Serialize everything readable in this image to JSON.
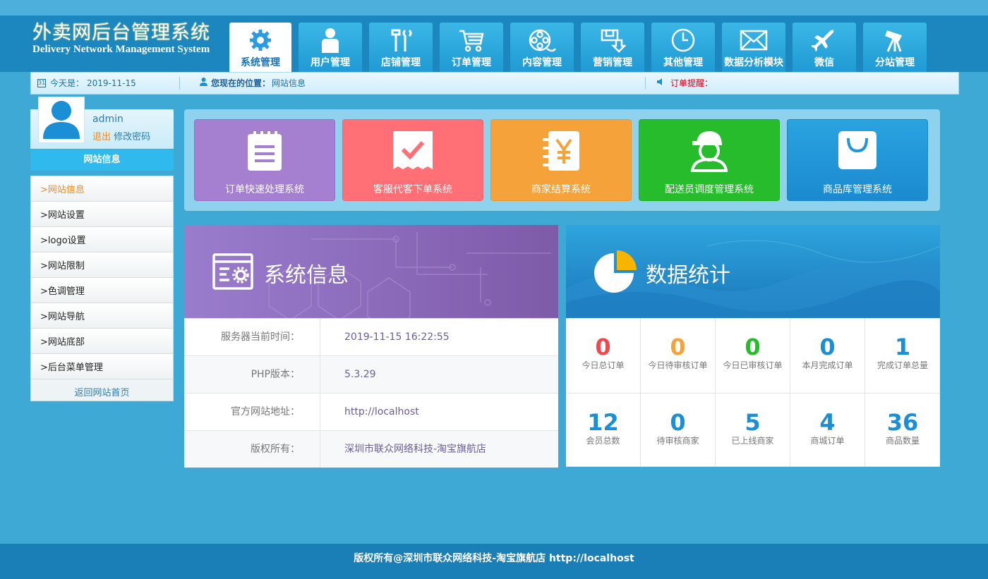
{
  "header": {
    "logo_cn": "外卖网后台管理系统",
    "logo_en": "Delivery Network Management System",
    "nav": [
      {
        "label": "系统管理",
        "icon": "gear-icon",
        "active": true
      },
      {
        "label": "用户管理",
        "icon": "user-icon"
      },
      {
        "label": "店铺管理",
        "icon": "tools-icon"
      },
      {
        "label": "订单管理",
        "icon": "cart-icon"
      },
      {
        "label": "内容管理",
        "icon": "film-reel-icon"
      },
      {
        "label": "营销管理",
        "icon": "download-box-icon"
      },
      {
        "label": "其他管理",
        "icon": "clock-icon"
      },
      {
        "label": "数据分析模块",
        "icon": "envelope-icon"
      },
      {
        "label": "微信",
        "icon": "airplane-icon"
      },
      {
        "label": "分站管理",
        "icon": "telescope-icon"
      }
    ]
  },
  "infobar": {
    "today_label": "今天是：",
    "today": "2019-11-15",
    "location_label": "您现在的位置：",
    "location": "网站信息",
    "order_alert": "订单提醒："
  },
  "sidebar": {
    "username": "admin",
    "logout": "退出",
    "change_password": "修改密码",
    "section_title": "网站信息",
    "items": [
      ">网站信息",
      ">网站设置",
      ">logo设置",
      ">网站限制",
      ">色调管理",
      ">网站导航",
      ">网站底部",
      ">后台菜单管理"
    ],
    "back": "返回网站首页"
  },
  "tiles": [
    {
      "label": "订单快速处理系统",
      "color": "#a57fd0",
      "icon": "clipboard-icon"
    },
    {
      "label": "客服代客下单系统",
      "color": "#ff6f75",
      "icon": "checkmark-receipt-icon"
    },
    {
      "label": "商家结算系统",
      "color": "#f5a23b",
      "icon": "yen-notebook-icon"
    },
    {
      "label": "配送员调度管理系统",
      "color": "#26bc2c",
      "icon": "courier-icon"
    },
    {
      "label": "商品库管理系统",
      "color": "#2396d8",
      "icon": "shopping-bag-icon"
    }
  ],
  "system_info": {
    "title": "系统信息",
    "rows": [
      {
        "key": "服务器当前时间：",
        "value": "2019-11-15 16:22:55"
      },
      {
        "key": "PHP版本：",
        "value": "5.3.29"
      },
      {
        "key": "官方网站地址：",
        "value": "http://localhost"
      },
      {
        "key": "版权所有：",
        "value": "深圳市联众网络科技-淘宝旗航店"
      }
    ]
  },
  "stats": {
    "title": "数据统计",
    "cells": [
      {
        "num": "0",
        "label": "今日总订单",
        "color": "#f0484e"
      },
      {
        "num": "0",
        "label": "今日待审核订单",
        "color": "#f5a23b"
      },
      {
        "num": "0",
        "label": "今日已审核订单",
        "color": "#26bc2c"
      },
      {
        "num": "0",
        "label": "本月完成订单",
        "color": "#1a8fd6"
      },
      {
        "num": "1",
        "label": "完成订单总量",
        "color": "#1a8fd6"
      },
      {
        "num": "12",
        "label": "会员总数",
        "color": "#1a8fd6"
      },
      {
        "num": "0",
        "label": "待审核商家",
        "color": "#1a8fd6"
      },
      {
        "num": "5",
        "label": "已上线商家",
        "color": "#1a8fd6"
      },
      {
        "num": "4",
        "label": "商城订单",
        "color": "#1a8fd6"
      },
      {
        "num": "36",
        "label": "商品数量",
        "color": "#1a8fd6"
      }
    ]
  },
  "footer": "版权所有@深圳市联众网络科技-淘宝旗航店 http://localhost"
}
